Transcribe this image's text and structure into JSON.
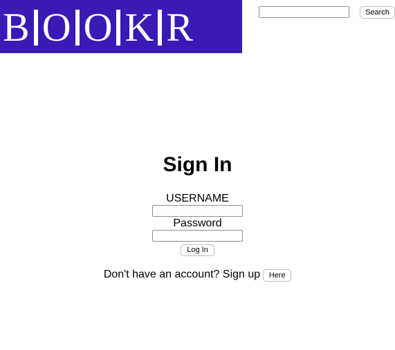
{
  "logo": {
    "letters": [
      "B",
      "O",
      "O",
      "K",
      "R"
    ],
    "background": "#3a19b5",
    "color": "#ffffff"
  },
  "header": {
    "search_placeholder": "",
    "search_value": "",
    "search_button_label": "Search"
  },
  "signin": {
    "title": "Sign In",
    "username_label": "USERNAME",
    "username_value": "",
    "password_label": "Password",
    "password_value": "",
    "login_button_label": "Log In",
    "signup_prompt": "Don't have an account? Sign up",
    "signup_button_label": "Here"
  }
}
